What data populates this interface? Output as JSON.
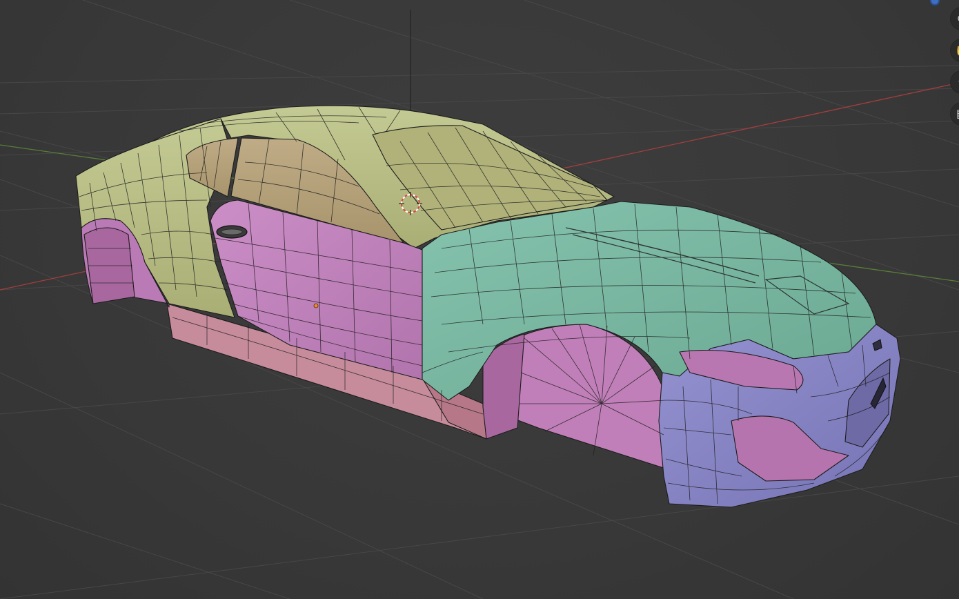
{
  "viewport": {
    "background_color": "#393939",
    "grid_line_color": "#474747",
    "x_axis_color": "#b04040",
    "y_axis_color": "#5c8a3a",
    "wire_color": "#1c1c1c"
  },
  "mesh_colors": {
    "roof_yellow": "#b9bf86",
    "glass_tan": "#b6a27a",
    "door_pink": "#c384bd",
    "hood_teal": "#7ebba6",
    "bumper_blue": "#8a87c6",
    "sill_pink": "#c98e9e",
    "wheelwell_pink": "#c07fb8"
  },
  "navigation_gizmo": {
    "zoom_icon": "magnifier-plus-icon",
    "pan_icon": "hand-icon",
    "camera_icon": "camera-icon",
    "ortho_icon": "grid-icon"
  }
}
